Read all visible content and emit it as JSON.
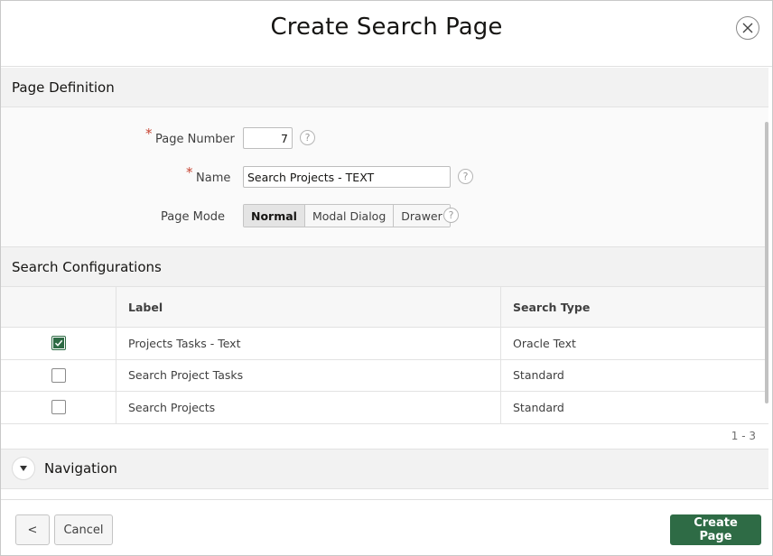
{
  "dialog": {
    "title": "Create Search Page"
  },
  "page_definition": {
    "header": "Page Definition",
    "page_number_label": "Page Number",
    "page_number_value": "7",
    "name_label": "Name",
    "name_value": "Search Projects - TEXT",
    "page_mode_label": "Page Mode",
    "page_mode_options": [
      "Normal",
      "Modal Dialog",
      "Drawer"
    ],
    "page_mode_selected": "Normal"
  },
  "search_configurations": {
    "header": "Search Configurations",
    "columns": [
      "Label",
      "Search Type"
    ],
    "rows": [
      {
        "label": "Projects Tasks - Text",
        "type": "Oracle Text",
        "checked": true
      },
      {
        "label": "Search Project Tasks",
        "type": "Standard",
        "checked": false
      },
      {
        "label": "Search Projects",
        "type": "Standard",
        "checked": false
      }
    ],
    "pagination": "1 - 3"
  },
  "navigation": {
    "header": "Navigation"
  },
  "footer": {
    "back_symbol": "<",
    "cancel_label": "Cancel",
    "create_label": "Create Page"
  },
  "colors": {
    "primary": "#2e6b45",
    "required": "#c74634"
  },
  "icons": {
    "close": "close-icon",
    "help": "help-icon",
    "check": "checkmark-icon",
    "collapse": "triangle-down-icon",
    "back": "chevron-left-icon"
  }
}
